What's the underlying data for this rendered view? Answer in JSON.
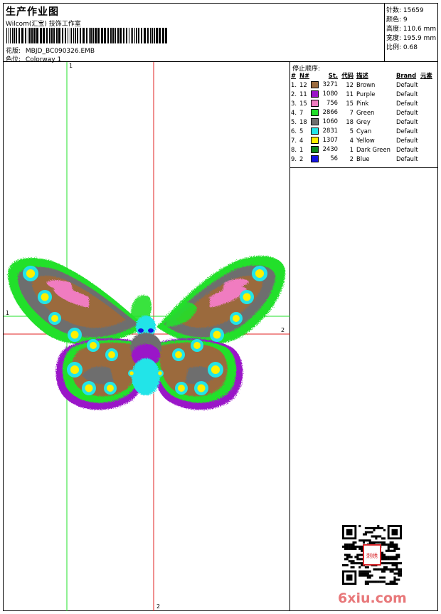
{
  "header": {
    "title": "生产作业图",
    "studio": "Wilcom(汇宝) 技饰工作室",
    "design_label": "花版:",
    "design_value": "MBJD_BC090326.EMB",
    "colorway_label": "色位:",
    "colorway_value": "Colorway 1"
  },
  "stats": [
    {
      "label": "针数:",
      "value": "15659"
    },
    {
      "label": "颜色:",
      "value": "9"
    },
    {
      "label": "高度:",
      "value": "110.6 mm"
    },
    {
      "label": "宽度:",
      "value": "195.9 mm"
    },
    {
      "label": "比例:",
      "value": "0.68"
    }
  ],
  "stop_sequence": {
    "title": "停止顺序:",
    "columns": [
      "#",
      "N#",
      "St.",
      "代码",
      "描述",
      "Brand",
      "元素"
    ],
    "rows": [
      {
        "idx": "1.",
        "n": "12",
        "color": "#9B6B3E",
        "st": "3271",
        "code": "12",
        "desc": "Brown",
        "brand": "Default"
      },
      {
        "idx": "2.",
        "n": "11",
        "color": "#9A14C8",
        "st": "1080",
        "code": "11",
        "desc": "Purple",
        "brand": "Default"
      },
      {
        "idx": "3.",
        "n": "15",
        "color": "#F07CC0",
        "st": "756",
        "code": "15",
        "desc": "Pink",
        "brand": "Default"
      },
      {
        "idx": "4.",
        "n": "7",
        "color": "#22E02A",
        "st": "2866",
        "code": "7",
        "desc": "Green",
        "brand": "Default"
      },
      {
        "idx": "5.",
        "n": "18",
        "color": "#6E6E6E",
        "st": "1060",
        "code": "18",
        "desc": "Grey",
        "brand": "Default"
      },
      {
        "idx": "6.",
        "n": "5",
        "color": "#22E4E8",
        "st": "2831",
        "code": "5",
        "desc": "Cyan",
        "brand": "Default"
      },
      {
        "idx": "7.",
        "n": "4",
        "color": "#FFF000",
        "st": "1307",
        "code": "4",
        "desc": "Yellow",
        "brand": "Default"
      },
      {
        "idx": "8.",
        "n": "1",
        "color": "#0E8A1E",
        "st": "2430",
        "code": "1",
        "desc": "Dark Green",
        "brand": "Default"
      },
      {
        "idx": "9.",
        "n": "2",
        "color": "#1414E0",
        "st": "56",
        "code": "2",
        "desc": "Blue",
        "brand": "Default"
      }
    ]
  },
  "axis_labels": {
    "v_top": "1",
    "h_left": "1",
    "h_right": "2",
    "v_bottom": "2"
  },
  "watermark": "6xiu.com",
  "seal_text": "刺绣图版"
}
